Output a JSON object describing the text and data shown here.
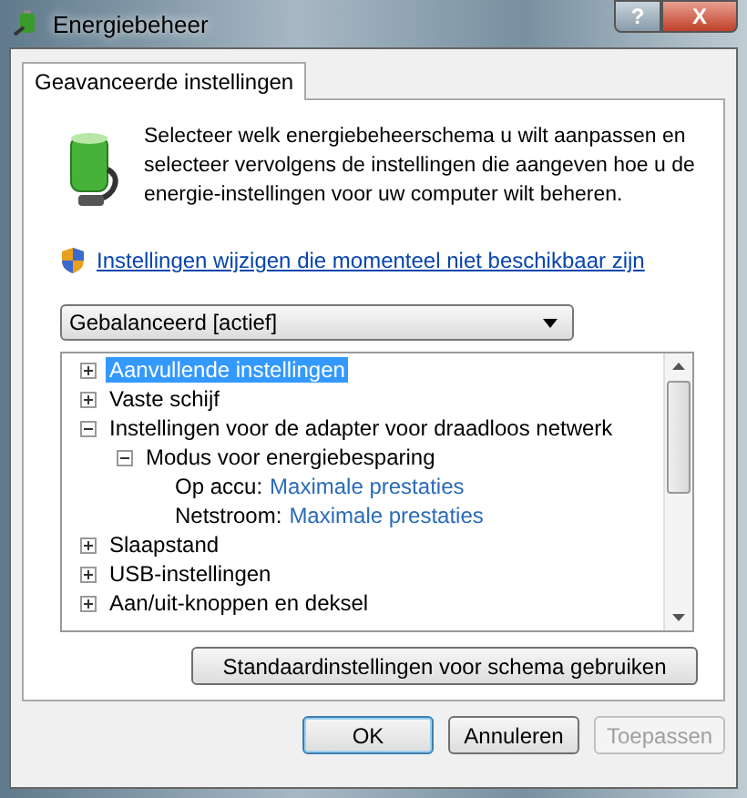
{
  "window": {
    "title": "Energiebeheer",
    "help_button": "?",
    "close_button": "X"
  },
  "tabs": [
    {
      "label": "Geavanceerde instellingen",
      "selected": true
    }
  ],
  "intro": "Selecteer welk energiebeheerschema u wilt aanpassen en selecteer vervolgens de instellingen die aangeven hoe u de energie-instellingen voor uw computer wilt beheren.",
  "link": "Instellingen wijzigen die momenteel niet beschikbaar zijn",
  "scheme_dropdown": {
    "value": "Gebalanceerd [actief]"
  },
  "tree": [
    {
      "label": "Aanvullende instellingen",
      "expanded": false,
      "selected": true
    },
    {
      "label": "Vaste schijf",
      "expanded": false,
      "selected": false
    },
    {
      "label": "Instellingen voor de adapter voor draadloos netwerk",
      "expanded": true,
      "selected": false,
      "children": [
        {
          "label": "Modus voor energiebesparing",
          "expanded": true,
          "selected": false,
          "settings": [
            {
              "label": "Op accu:",
              "value": "Maximale prestaties"
            },
            {
              "label": "Netstroom:",
              "value": "Maximale prestaties"
            }
          ]
        }
      ]
    },
    {
      "label": "Slaapstand",
      "expanded": false,
      "selected": false
    },
    {
      "label": "USB-instellingen",
      "expanded": false,
      "selected": false
    },
    {
      "label": "Aan/uit-knoppen en deksel",
      "expanded": false,
      "selected": false
    }
  ],
  "restore_button": "Standaardinstellingen voor schema gebruiken",
  "buttons": [
    {
      "label": "OK",
      "kind": "default",
      "disabled": false
    },
    {
      "label": "Annuleren",
      "kind": "normal",
      "disabled": false
    },
    {
      "label": "Toepassen",
      "kind": "normal",
      "disabled": true
    }
  ]
}
